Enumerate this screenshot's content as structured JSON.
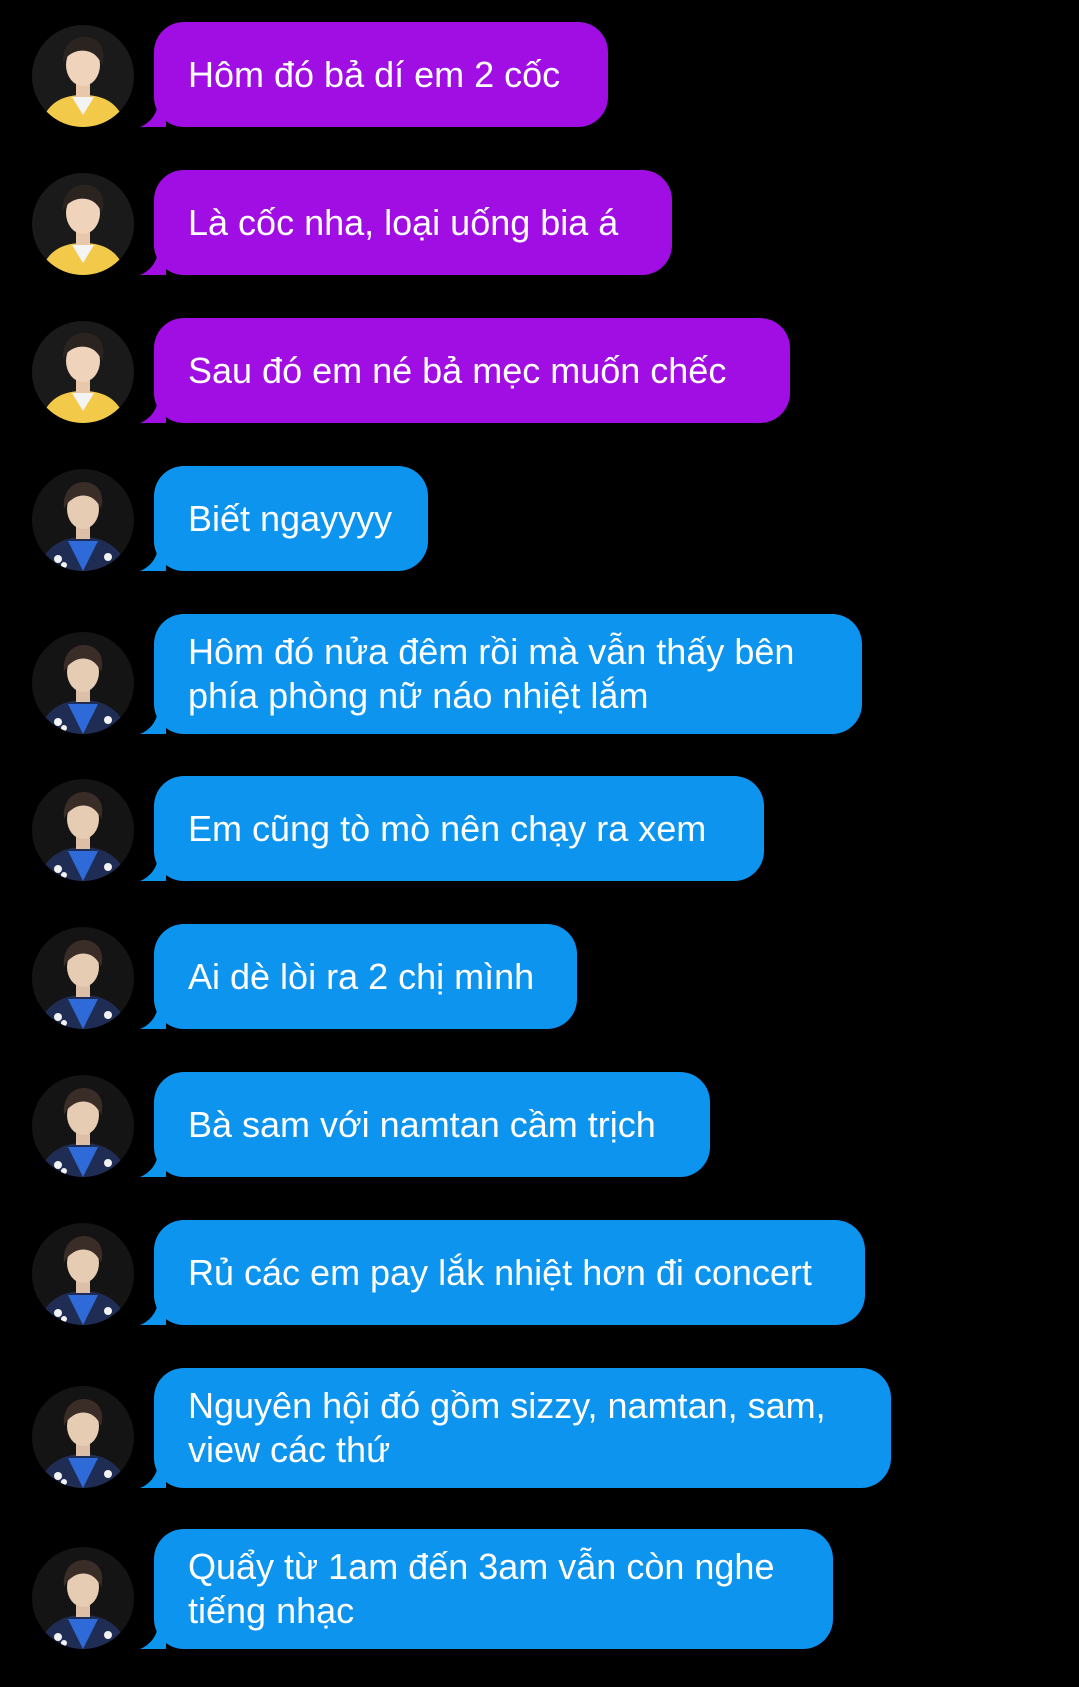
{
  "colors": {
    "background": "#000000",
    "purple_bubble": "#a10ee4",
    "blue_bubble": "#0d94ee",
    "text": "#ffffff"
  },
  "messages": [
    {
      "sender": "purple",
      "avatar": "avatar-yellow-jacket",
      "text": "Hôm đó bả dí em 2 cốc"
    },
    {
      "sender": "purple",
      "avatar": "avatar-yellow-jacket",
      "text": "Là cốc nha, loại uống bia á"
    },
    {
      "sender": "purple",
      "avatar": "avatar-yellow-jacket",
      "text": "Sau đó em né bả mẹc muốn chếc"
    },
    {
      "sender": "blue",
      "avatar": "avatar-blue-jacket",
      "text": "Biết ngayyyy"
    },
    {
      "sender": "blue",
      "avatar": "avatar-blue-jacket",
      "text": "Hôm đó nửa đêm rồi mà vẫn thấy bên\nphía phòng nữ náo nhiệt lắm"
    },
    {
      "sender": "blue",
      "avatar": "avatar-blue-jacket",
      "text": "Em cũng tò mò nên chạy ra xem"
    },
    {
      "sender": "blue",
      "avatar": "avatar-blue-jacket",
      "text": "Ai dè lòi ra 2 chị mình"
    },
    {
      "sender": "blue",
      "avatar": "avatar-blue-jacket",
      "text": "Bà sam với namtan cầm trịch"
    },
    {
      "sender": "blue",
      "avatar": "avatar-blue-jacket",
      "text": "Rủ các em pay lắk nhiệt hơn đi concert"
    },
    {
      "sender": "blue",
      "avatar": "avatar-blue-jacket",
      "text": "Nguyên hội đó gồm sizzy, namtan, sam,\nview các thứ"
    },
    {
      "sender": "blue",
      "avatar": "avatar-blue-jacket",
      "text": "Quẩy từ 1am đến 3am vẫn còn nghe\ntiếng nhạc"
    }
  ]
}
